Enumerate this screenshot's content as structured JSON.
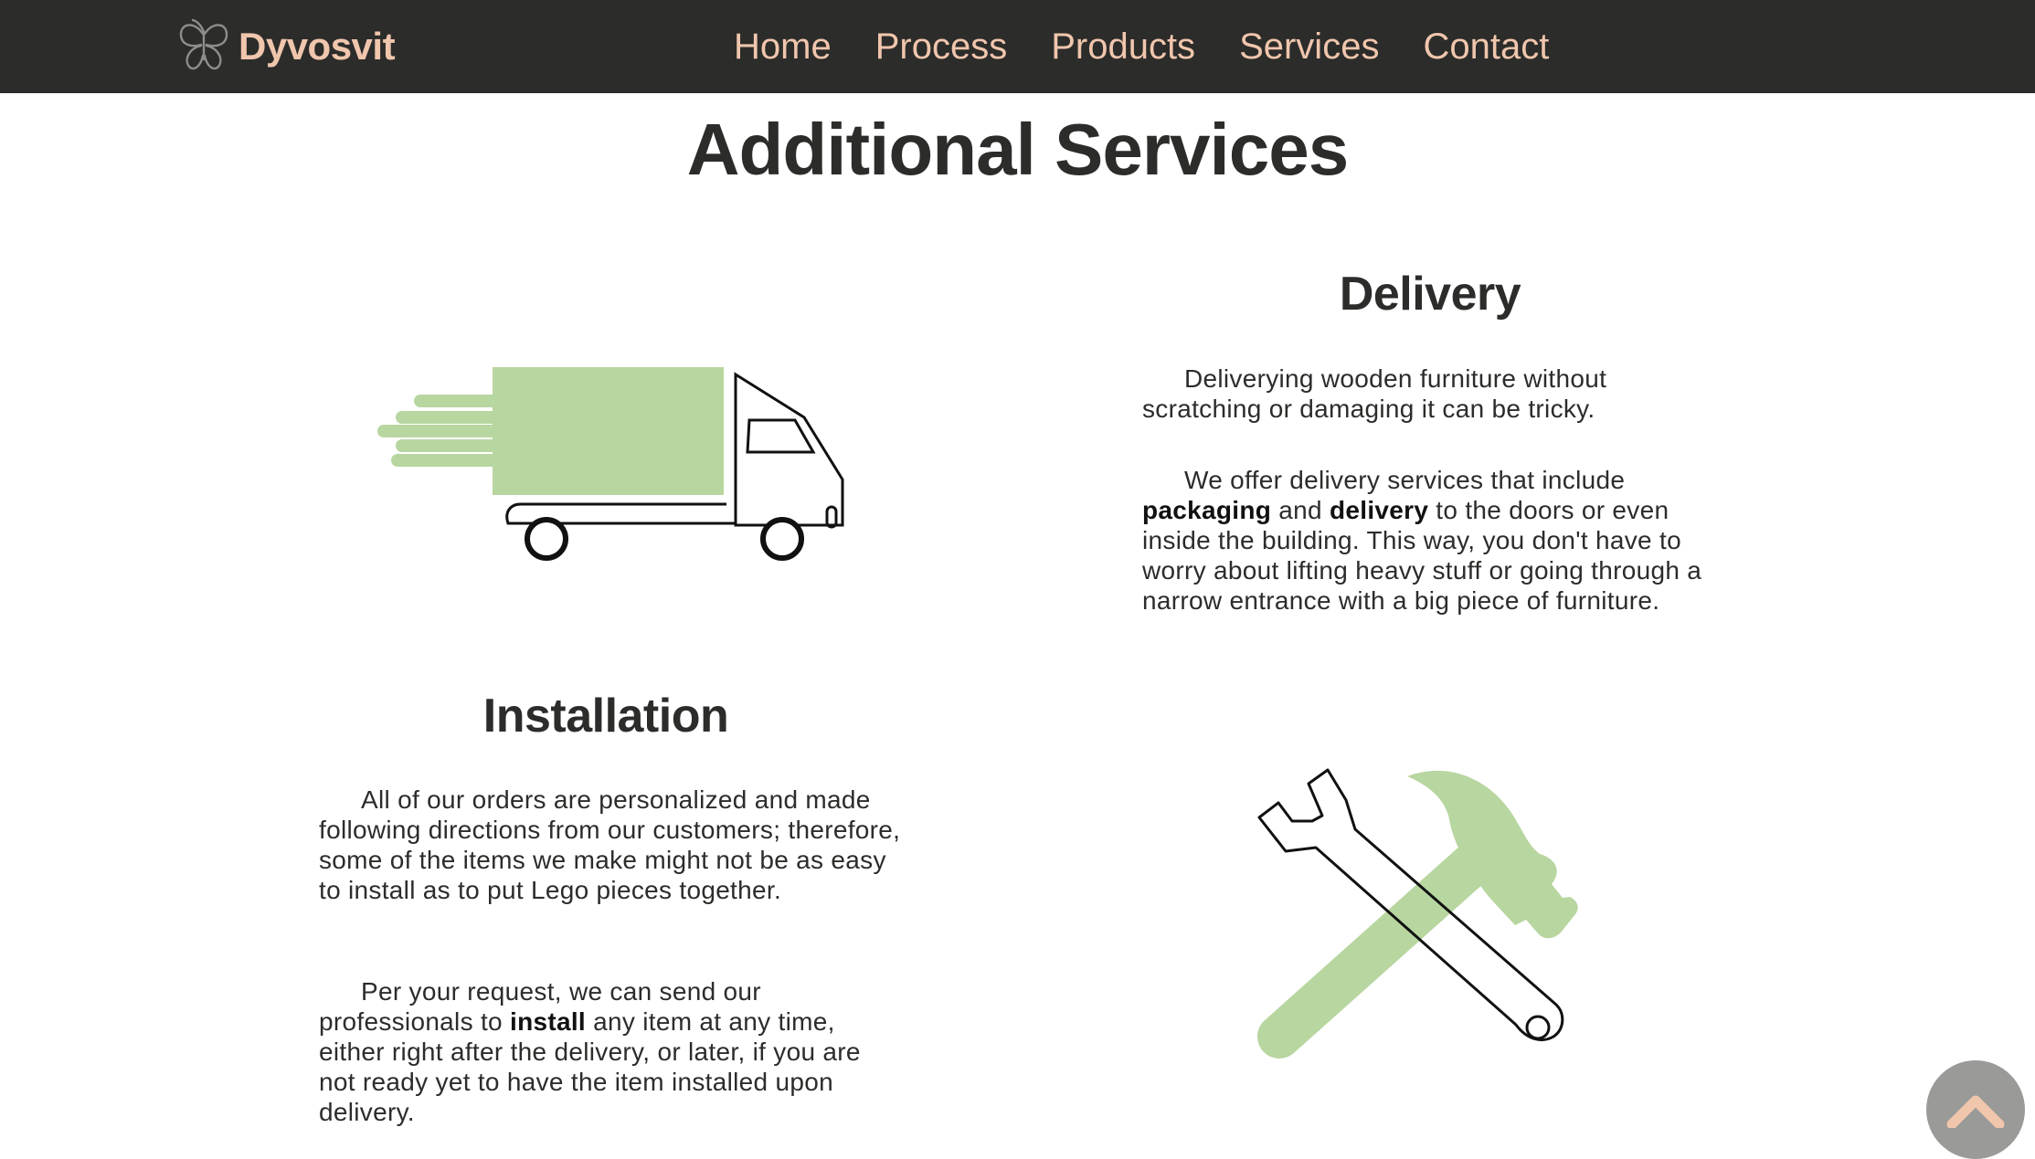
{
  "header": {
    "brand": "Dyvosvit",
    "nav": [
      "Home",
      "Process",
      "Products",
      "Services",
      "Contact"
    ]
  },
  "main": {
    "title": "Additional Services",
    "delivery": {
      "title": "Delivery",
      "p1": "Deliverying wooden furniture without scratching or damaging it can be tricky.",
      "p2": {
        "t1": "We offer delivery services that include ",
        "b1": "packaging",
        "t2": " and ",
        "b2": "delivery",
        "t3": " to the doors or even inside the building. This way, you don't have to worry about lifting heavy stuff or going through a narrow entrance with a big piece of furniture."
      }
    },
    "installation": {
      "title": "Installation",
      "p1": "All of our orders are personalized and made following directions from our customers; therefore, some of the items we make might not be as easy to install as to put Lego pieces together.",
      "p2": {
        "t1": "Per your request, we can send our professionals to ",
        "b1": "install",
        "t2": " any item at any time, either right after the delivery, or later, if you are not ready yet to have the item installed upon delivery."
      }
    }
  },
  "colors": {
    "header_bg": "#2c2c2a",
    "nav_text": "#f0c6ad",
    "accent_green": "#b8d6a0",
    "scroll_button": "#9a9a98"
  },
  "icons": {
    "brand": "butterfly-logo-icon",
    "delivery": "delivery-truck-icon",
    "installation": "wrench-hammer-icon",
    "scroll_top": "chevron-up-icon"
  }
}
